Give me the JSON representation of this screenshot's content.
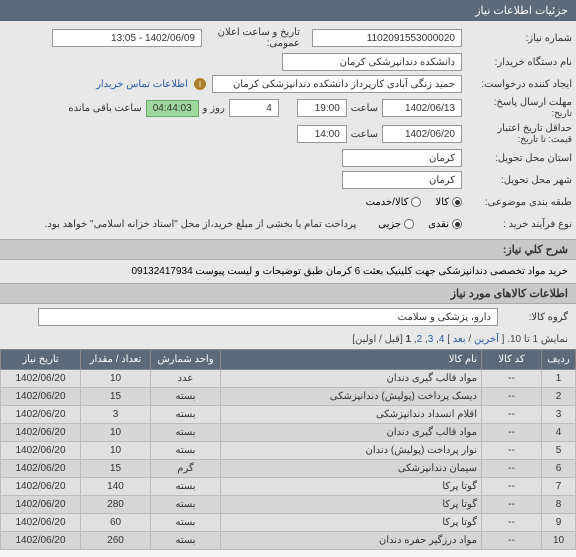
{
  "header": {
    "title": "جزئیات اطلاعات نیاز"
  },
  "form": {
    "need_no_label": "شماره نیاز:",
    "need_no": "1102091553000020",
    "announce_label": "تاریخ و ساعت اعلان عمومی:",
    "announce": "1402/06/09 - 13:05",
    "buyer_label": "نام دستگاه خریدار:",
    "buyer": "دانشکده دندانپزشکی کرمان",
    "requester_label": "ایجاد کننده درخواست:",
    "requester": "حمید زنگی آبادی کارپرداز دانشکده دندانپزشکی کرمان",
    "requester_link": "اطلاعات تماس خریدار",
    "send_deadline_label": "مهلت ارسال پاسخ:",
    "send_head": "تاریخ:",
    "date1": "1402/06/13",
    "time_lbl": "ساعت",
    "time1": "19:00",
    "days": "4",
    "days_lbl": "روز و",
    "remain": "04:44:03",
    "remain_lbl": "ساعت باقی مانده",
    "valid_label": "حداقل تاریخ اعتبار",
    "valid_head": "قیمت: تا تاریخ:",
    "date2": "1402/06/20",
    "time2": "14:00",
    "province_label": "استان محل تحویل:",
    "province": "کرمان",
    "city_label": "شهر محل تحویل:",
    "city": "کرمان",
    "class_label": "طبقه بندی موضوعی:",
    "class_goods": "کالا",
    "class_service": "کالا/خدمت",
    "buy_type_label": "نوع فرآیند خرید :",
    "buy_cash": "نقدی",
    "buy_partial": "جزیی",
    "buy_note": "پرداخت تمام یا بخشی از مبلغ خرید،از محل \"اسناد خزانه اسلامی\" خواهد بود."
  },
  "desc": {
    "title": "شرح کلي نیاز:",
    "text": "خرید مواد تخصصی دندانپزشکی جهت کلینیک بعثت 6 کرمان طبق توضیحات و لیست پیوست 09132417934"
  },
  "section2": "اطلاعات کالاهای مورد نیاز",
  "group": {
    "label": "گروه کالا:",
    "value": "دارو، پزشکی و سلامت"
  },
  "pager": {
    "prefix": "نمایش 1 تا 10. [ ",
    "last": "آخرین",
    "sep": " / ",
    "next": "بعد",
    "mid": " ] ",
    "p4": "4",
    "p3": "3",
    "p2": "2",
    "p1": "1",
    "suffix": " [قبل / اولین]"
  },
  "table": {
    "headers": {
      "row": "ردیف",
      "code": "کد کالا",
      "name": "نام کالا",
      "unit": "واحد شمارش",
      "qty": "تعداد / مقدار",
      "date": "تاریخ نیاز"
    },
    "rows": [
      {
        "r": "1",
        "code": "--",
        "name": "مواد قالب گیری دندان",
        "unit": "عدد",
        "qty": "10",
        "date": "1402/06/20"
      },
      {
        "r": "2",
        "code": "--",
        "name": "دیسک پرداخت (پولیش) دندانپزشکی",
        "unit": "بسته",
        "qty": "15",
        "date": "1402/06/20"
      },
      {
        "r": "3",
        "code": "--",
        "name": "اقلام انسداد دندانپزشکی",
        "unit": "بسته",
        "qty": "3",
        "date": "1402/06/20"
      },
      {
        "r": "4",
        "code": "--",
        "name": "مواد قالب گیری دندان",
        "unit": "بسته",
        "qty": "10",
        "date": "1402/06/20"
      },
      {
        "r": "5",
        "code": "--",
        "name": "نوار پرداخت (پولیش) دندان",
        "unit": "بسته",
        "qty": "10",
        "date": "1402/06/20"
      },
      {
        "r": "6",
        "code": "--",
        "name": "سیمان دندانپزشکی",
        "unit": "گرم",
        "qty": "15",
        "date": "1402/06/20"
      },
      {
        "r": "7",
        "code": "--",
        "name": "گوتا پرکا",
        "unit": "بسته",
        "qty": "140",
        "date": "1402/06/20"
      },
      {
        "r": "8",
        "code": "--",
        "name": "گوتا پرکا",
        "unit": "بسته",
        "qty": "280",
        "date": "1402/06/20"
      },
      {
        "r": "9",
        "code": "--",
        "name": "گوتا پرکا",
        "unit": "بسته",
        "qty": "60",
        "date": "1402/06/20"
      },
      {
        "r": "10",
        "code": "--",
        "name": "مواد درزگیر حفره دندان",
        "unit": "بسته",
        "qty": "260",
        "date": "1402/06/20"
      }
    ]
  }
}
